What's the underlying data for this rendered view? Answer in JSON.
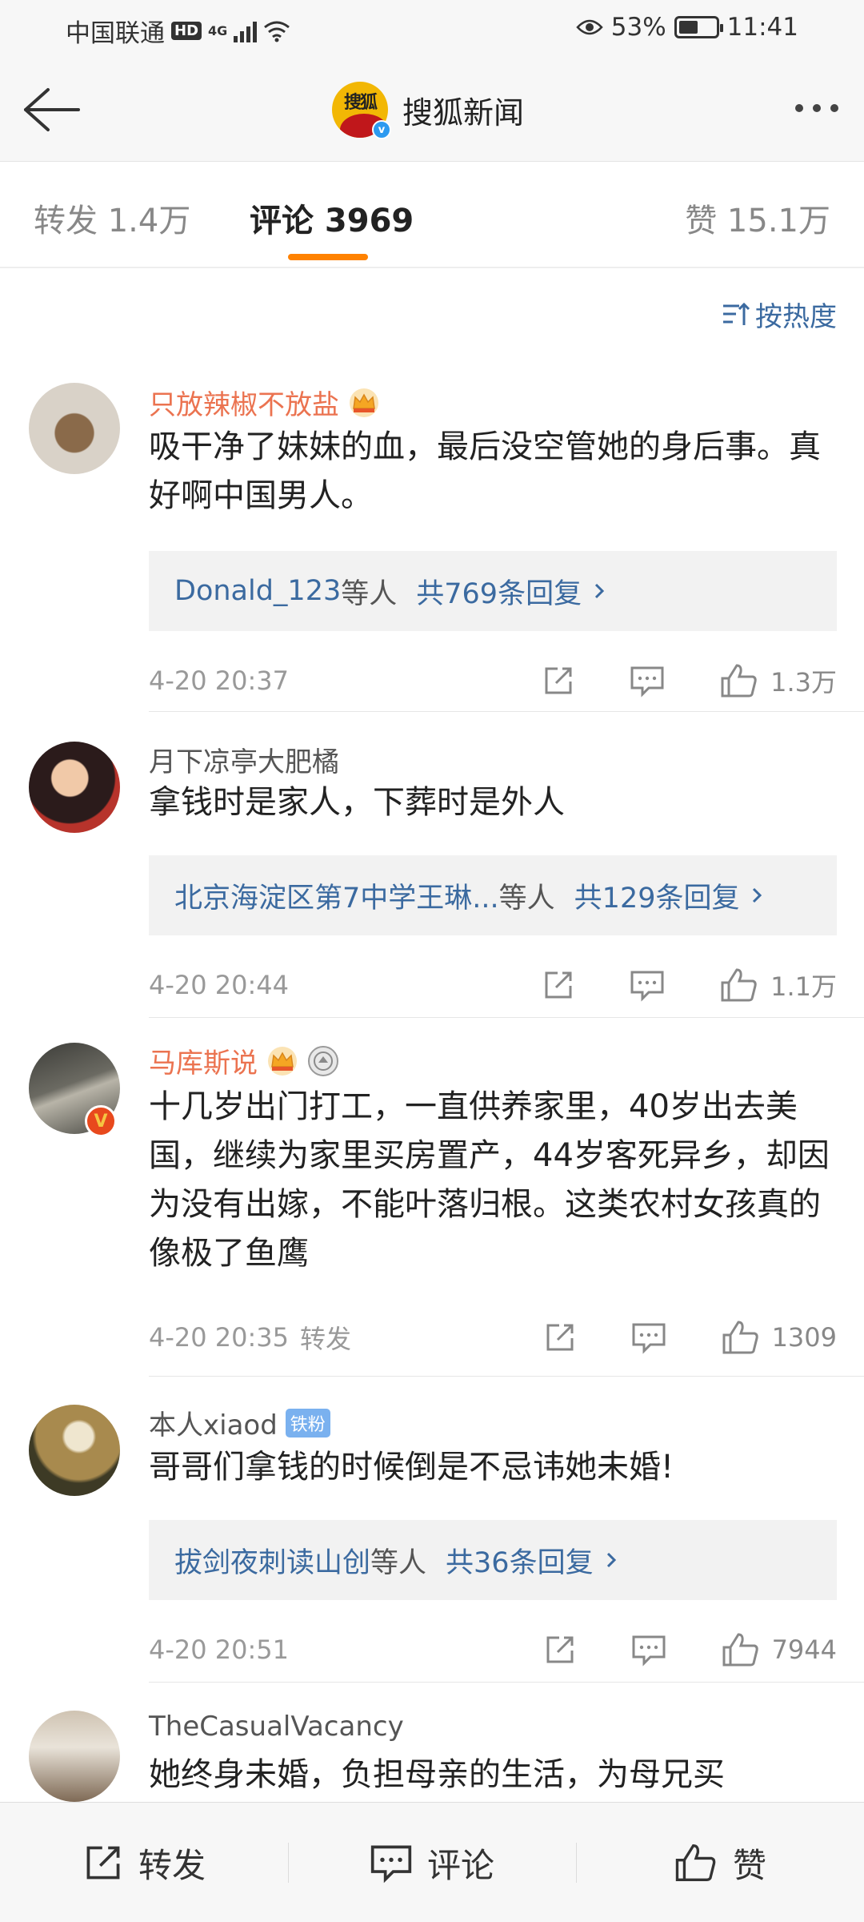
{
  "status_bar": {
    "carrier": "中国联通",
    "hd": "HD",
    "network": "4G",
    "battery": "53%",
    "battery_level": 0.53,
    "time": "11:41"
  },
  "header": {
    "logo_text": "搜狐",
    "title": "搜狐新闻"
  },
  "tabs": [
    {
      "label": "转发 1.4万",
      "active": false
    },
    {
      "label": "评论 3969",
      "active": true
    },
    {
      "label": "赞 15.1万",
      "active": false
    }
  ],
  "sort": {
    "label": "按热度"
  },
  "comments": [
    {
      "username": "只放辣椒不放盐",
      "text": "吸干净了妹妹的血，最后没空管她的身后事。真好啊中国男人。",
      "replies_who": "Donald_123",
      "replies_etc": "等人",
      "replies_total": "共769条回复",
      "time": "4-20 20:37",
      "likes": "1.3万"
    },
    {
      "username": "月下凉亭大肥橘",
      "text": "拿钱时是家人，下葬时是外人",
      "replies_who": "北京海淀区第7中学王琳...",
      "replies_etc": "等人",
      "replies_total": "共129条回复",
      "time": "4-20 20:44",
      "likes": "1.1万"
    },
    {
      "username": "马库斯说",
      "text": "十几岁出门打工，一直供养家里，40岁出去美国，继续为家里买房置产，44岁客死异乡，却因为没有出嫁，不能叶落归根。这类农村女孩真的像极了鱼鹰",
      "time": "4-20 20:35",
      "forward": "转发",
      "likes": "1309"
    },
    {
      "username": "本人xiaod",
      "badge": "铁粉",
      "text": "哥哥们拿钱的时候倒是不忌讳她未婚!",
      "replies_who": "拔剑夜刺读山创",
      "replies_etc": "等人",
      "replies_total": "共36条回复",
      "time": "4-20 20:51",
      "likes": "7944"
    },
    {
      "username": "TheCasualVacancy",
      "text": "她终身未婚，负担母亲的生活，为母兄买"
    }
  ],
  "bottom_bar": {
    "forward": "转发",
    "comment": "评论",
    "like": "赞"
  },
  "colors": {
    "accent": "#ff8200",
    "link": "#3b6aa0",
    "vip_name": "#eb7350"
  },
  "icons": [
    "back-arrow-icon",
    "more-icon",
    "sort-icon",
    "share-icon",
    "comment-icon",
    "like-icon",
    "crown-icon",
    "medal-icon",
    "verified-icon"
  ]
}
